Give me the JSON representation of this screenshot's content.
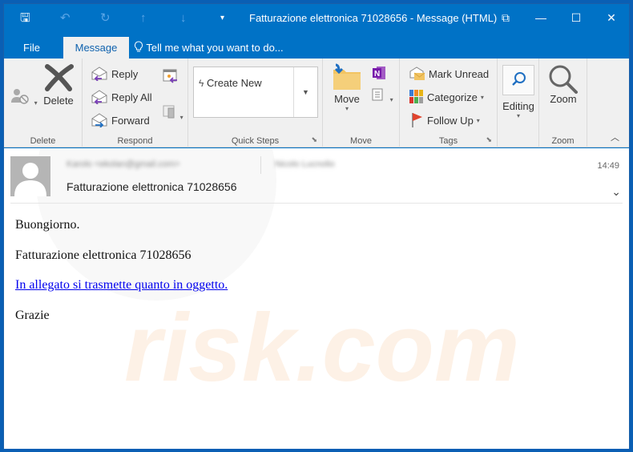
{
  "window": {
    "title": "Fatturazione elettronica 71028656 - Message (HTML)",
    "controls": {
      "restore_ribbon": "⧉",
      "minimize": "—",
      "maximize": "☐",
      "close": "✕"
    }
  },
  "quick_access": {
    "save_icon": "🖫",
    "undo_icon": "↶",
    "redo_icon": "↻",
    "previous_icon": "↑",
    "next_icon": "↓",
    "customize_icon": "▾"
  },
  "tabs": {
    "file": "File",
    "message": "Message",
    "tell_me": "Tell me what you want to do..."
  },
  "ribbon": {
    "delete_group": {
      "label": "Delete",
      "delete_button": "Delete"
    },
    "respond_group": {
      "label": "Respond",
      "reply": "Reply",
      "reply_all": "Reply All",
      "forward": "Forward"
    },
    "quick_steps_group": {
      "label": "Quick Steps",
      "create_new": "Create New"
    },
    "move_group": {
      "label": "Move",
      "move_button": "Move"
    },
    "tags_group": {
      "label": "Tags",
      "mark_unread": "Mark Unread",
      "categorize": "Categorize",
      "follow_up": "Follow Up"
    },
    "editing_group": {
      "editing_button": "Editing"
    },
    "zoom_group": {
      "label": "Zoom",
      "zoom_button": "Zoom"
    }
  },
  "message": {
    "sender": "Karolo <ekolan@gmail.com>",
    "recipient": "Nicolo Lucnolio",
    "time": "14:49",
    "subject": "Fatturazione elettronica 71028656",
    "body": {
      "greeting": "Buongiorno.",
      "line1": "Fatturazione elettronica 71028656",
      "link_text": "In allegato si trasmette quanto in oggetto.",
      "closing": "Grazie"
    }
  },
  "colors": {
    "accent": "#0072c6",
    "ribbon_bg": "#f0f0f0",
    "link": "#0000ee"
  }
}
